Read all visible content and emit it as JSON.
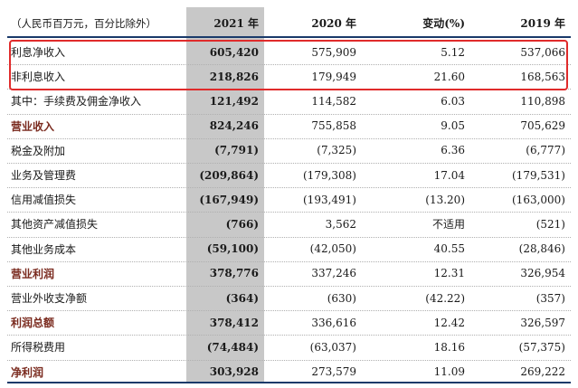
{
  "header": {
    "unit_label": "（人民币百万元，百分比除外）",
    "col_2021": "2021 年",
    "col_2020": "2020 年",
    "col_change": "变动(%)",
    "col_2019": "2019 年"
  },
  "rows": [
    {
      "label": "利息净收入",
      "v2021": "605,420",
      "v2020": "575,909",
      "chg": "5.12",
      "v2019": "537,066",
      "bold": false
    },
    {
      "label": "非利息收入",
      "v2021": "218,826",
      "v2020": "179,949",
      "chg": "21.60",
      "v2019": "168,563",
      "bold": false
    },
    {
      "label": "其中：手续费及佣金净收入",
      "v2021": "121,492",
      "v2020": "114,582",
      "chg": "6.03",
      "v2019": "110,898",
      "bold": false
    },
    {
      "label": "营业收入",
      "v2021": "824,246",
      "v2020": "755,858",
      "chg": "9.05",
      "v2019": "705,629",
      "bold": true
    },
    {
      "label": "税金及附加",
      "v2021": "(7,791)",
      "v2020": "(7,325)",
      "chg": "6.36",
      "v2019": "(6,777)",
      "bold": false
    },
    {
      "label": "业务及管理费",
      "v2021": "(209,864)",
      "v2020": "(179,308)",
      "chg": "17.04",
      "v2019": "(179,531)",
      "bold": false
    },
    {
      "label": "信用减值损失",
      "v2021": "(167,949)",
      "v2020": "(193,491)",
      "chg": "(13.20)",
      "v2019": "(163,000)",
      "bold": false
    },
    {
      "label": "其他资产减值损失",
      "v2021": "(766)",
      "v2020": "3,562",
      "chg": "不适用",
      "v2019": "(521)",
      "bold": false
    },
    {
      "label": "其他业务成本",
      "v2021": "(59,100)",
      "v2020": "(42,050)",
      "chg": "40.55",
      "v2019": "(28,846)",
      "bold": false
    },
    {
      "label": "营业利润",
      "v2021": "378,776",
      "v2020": "337,246",
      "chg": "12.31",
      "v2019": "326,954",
      "bold": true
    },
    {
      "label": "营业外收支净额",
      "v2021": "(364)",
      "v2020": "(630)",
      "chg": "(42.22)",
      "v2019": "(357)",
      "bold": false
    },
    {
      "label": "利润总额",
      "v2021": "378,412",
      "v2020": "336,616",
      "chg": "12.42",
      "v2019": "326,597",
      "bold": true
    },
    {
      "label": "所得税费用",
      "v2021": "(74,484)",
      "v2020": "(63,037)",
      "chg": "18.16",
      "v2019": "(57,375)",
      "bold": false
    },
    {
      "label": "净利润",
      "v2021": "303,928",
      "v2020": "273,579",
      "chg": "11.09",
      "v2019": "269,222",
      "bold": true
    }
  ],
  "colors": {
    "highlight_box": "#e02b2b",
    "rule": "#1a3a6a",
    "shaded_column": "#c8c8c8",
    "bold_label": "#7a2a1e"
  }
}
